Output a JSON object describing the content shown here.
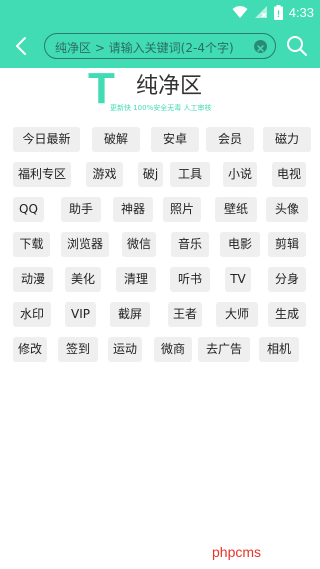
{
  "status_bar": {
    "time": "4:33"
  },
  "search": {
    "text": "纯净区 > 请输入关键词(2-4个字)"
  },
  "logo": {
    "letter": "T",
    "title": "纯净区",
    "subtitle": "更新快 100%安全无毒 人工审核"
  },
  "tag_rows": [
    [
      "今日最新",
      "破解",
      "安卓",
      "会员",
      "磁力"
    ],
    [
      "福利专区",
      "游戏",
      "破j",
      "工具",
      "小说",
      "电视"
    ],
    [
      "QQ",
      "助手",
      "神器",
      "照片",
      "壁纸",
      "头像"
    ],
    [
      "下载",
      "浏览器",
      "微信",
      "音乐",
      "电影",
      "剪辑"
    ],
    [
      "动漫",
      "美化",
      "清理",
      "听书",
      "TV",
      "分身"
    ],
    [
      "水印",
      "VIP",
      "截屏",
      "王者",
      "大师",
      "生成"
    ],
    [
      "修改",
      "签到",
      "运动",
      "微商",
      "去广告",
      "相机"
    ]
  ],
  "watermark": "phpcms"
}
